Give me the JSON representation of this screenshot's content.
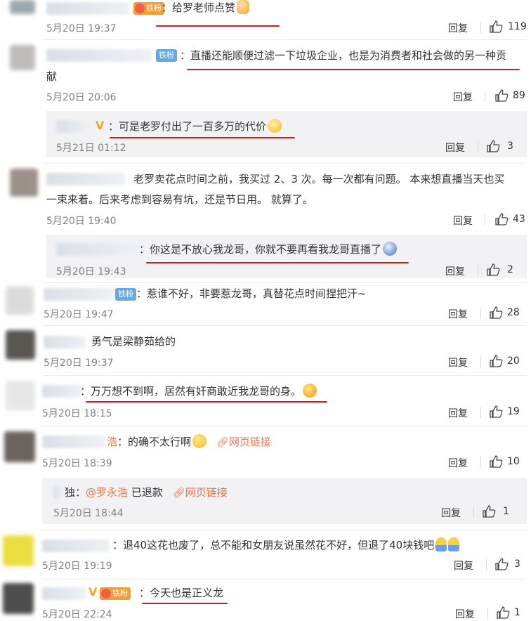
{
  "reply_label": "回复",
  "comments": [
    {
      "text": "给罗老师点赞",
      "time": "5月20日 19:37",
      "likes": "119",
      "badge": "铁粉",
      "emoji": "thumb"
    },
    {
      "text_line1": "直播还能顺便过滤一下垃圾企业，也是为消费者和社会做的另一种贡",
      "text_line2": "献",
      "time": "5月20日 20:06",
      "likes": "89",
      "badge": "铁粉"
    },
    {
      "text": "可是老罗付出了一百多万的代价",
      "time": "5月21日 01:12",
      "likes": "3",
      "emoji": "sad"
    },
    {
      "text_line1": "老罗卖花点时间之前，我买过 2、3 次。每一次都有问题。 本来想直播当天也买",
      "text_line2": "一束来着。后来考虑到容易有坑，还是节日用。 就算了。",
      "time": "5月20日 19:40",
      "likes": "43"
    },
    {
      "text": "你这是不放心我龙哥，你就不要再看我龙哥直播了",
      "time": "5月20日 19:43",
      "likes": "2",
      "emoji": "blue"
    },
    {
      "text": "惹谁不好，非要惹龙哥，真替花点时间捏把汗~",
      "time": "5月20日 19:47",
      "likes": "28",
      "badge": "铁粉"
    },
    {
      "text": "勇气是梁静茹给的",
      "time": "5月20日 19:37",
      "likes": "20"
    },
    {
      "text": "万万想不到啊，居然有奸商敢近我龙哥的身。",
      "time": "5月20日 18:15",
      "likes": "19",
      "emoji": "laugh"
    },
    {
      "name_tail": "浩",
      "text": "的确不太行啊",
      "link": "网页链接",
      "time": "5月20日 18:39",
      "likes": "10",
      "emoji": "sweat"
    },
    {
      "name_tail": "独",
      "mention": "@罗永浩",
      "text": "已退款",
      "link": "网页链接",
      "time": "5月20日 18:44",
      "likes": "1"
    },
    {
      "text": "退40这花也废了，总不能和女朋友说虽然花不好，但退了40块钱吧",
      "time": "5月20日 19:19",
      "likes": "3",
      "emoji": "person"
    },
    {
      "text": "今天也是正义龙",
      "time": "5月20日 22:24",
      "likes": "1",
      "badge": "铁粉"
    }
  ]
}
